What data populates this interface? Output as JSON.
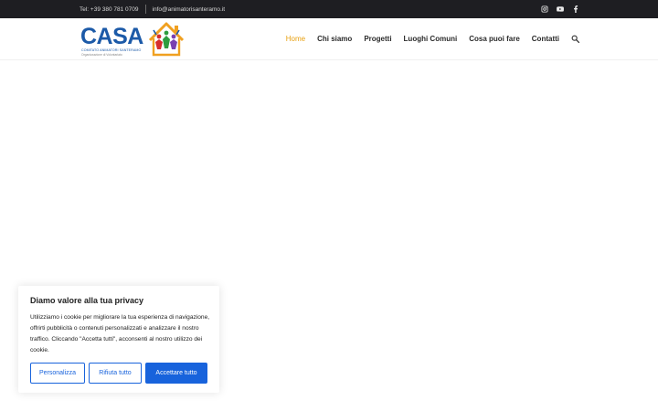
{
  "topbar": {
    "phone": "Tel: +39 380 781 0709",
    "email": "info@animatorisanteramo.it",
    "social": [
      "instagram-icon",
      "youtube-icon",
      "facebook-icon"
    ]
  },
  "logo": {
    "name": "CASA",
    "tagline": "COMITATO ANIMATORI SANTERAMO",
    "subtitle": "Organizzazione di Volontariato"
  },
  "nav": {
    "items": [
      {
        "label": "Home",
        "active": true
      },
      {
        "label": "Chi siamo",
        "active": false
      },
      {
        "label": "Progetti",
        "active": false
      },
      {
        "label": "Luoghi Comuni",
        "active": false
      },
      {
        "label": "Cosa puoi fare",
        "active": false
      },
      {
        "label": "Contatti",
        "active": false
      }
    ]
  },
  "cookie": {
    "title": "Diamo valore alla tua privacy",
    "text": "Utilizziamo i cookie per migliorare la tua esperienza di navigazione, offrirti pubblicità o contenuti personalizzati e analizzare il nostro traffico. Cliccando \"Accetta tutti\", acconsenti al nostro utilizzo dei cookie.",
    "customize_label": "Personalizza",
    "reject_label": "Rifiuta tutto",
    "accept_label": "Accettare tutto"
  },
  "colors": {
    "accent": "#e8a010",
    "brand": "#1c5aa8",
    "button": "#1863dc",
    "topbar": "#1e1e22"
  }
}
